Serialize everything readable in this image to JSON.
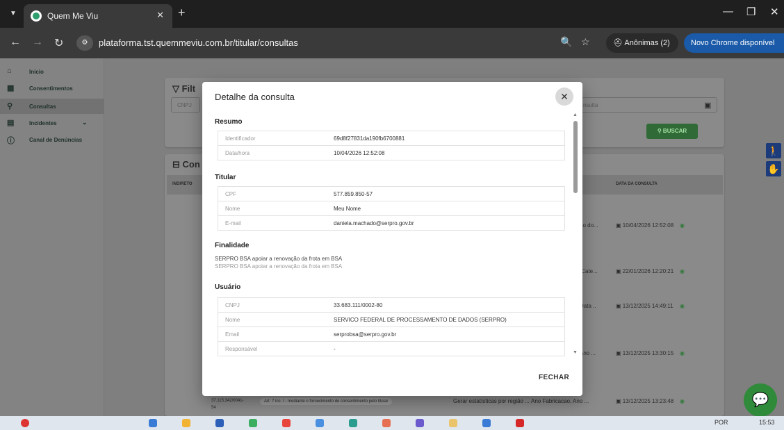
{
  "browser": {
    "tab_title": "Quem Me Viu",
    "url": "plataforma.tst.quemmeviu.com.br/titular/consultas",
    "incognito_label": "Anônimas (2)",
    "update_label": "Novo Chrome disponível"
  },
  "sidebar": {
    "items": [
      {
        "label": "Início",
        "icon": "home-icon"
      },
      {
        "label": "Consentimentos",
        "icon": "grid-icon"
      },
      {
        "label": "Consultas",
        "icon": "search-icon"
      },
      {
        "label": "Incidentes",
        "icon": "alert-icon"
      },
      {
        "label": "Canal de Denúncias",
        "icon": "info-icon"
      }
    ]
  },
  "background": {
    "filter_title": "Filt",
    "cnpj_placeholder": "CNPJ",
    "date_placeholder": "nsulta",
    "buscar_label": "BUSCAR",
    "list_title": "Con",
    "col_indireto": "INDIRETO",
    "col_data": "DATA DA CONSULTA",
    "rows": [
      {
        "frag": "ão do...",
        "date": "10/04/2026 12:52:08"
      },
      {
        "frag": "/Cate...",
        "date": "22/01/2026 12:20:21"
      },
      {
        "frag": "Data ..",
        "date": "13/12/2025 14:49:11"
      },
      {
        "frag": "Ano ...",
        "date": "13/12/2025 13:30:15"
      }
    ],
    "last_row": {
      "cnpj": "37.115.342/0041-",
      "cnpj2": "54",
      "legal_basis": "Art. 7 inc. I - mediante o fornecimento de consentimento pelo titular",
      "purpose": "Gerar estatísticas por região ...",
      "data": "Ano Fabricacao, Ano ...",
      "date": "13/12/2025 13:23:48"
    }
  },
  "modal": {
    "title": "Detalhe da consulta",
    "close_label": "FECHAR",
    "resumo": {
      "title": "Resumo",
      "rows": [
        {
          "key": "Identificador",
          "value": "69d8f27831da190fb6700881"
        },
        {
          "key": "Data/hora",
          "value": "10/04/2026 12:52:08"
        }
      ]
    },
    "titular": {
      "title": "Titular",
      "rows": [
        {
          "key": "CPF",
          "value": "577.859.850-57"
        },
        {
          "key": "Nome",
          "value": "Meu Nome"
        },
        {
          "key": "E-mail",
          "value": "daniela.machado@serpro.gov.br"
        }
      ]
    },
    "finalidade": {
      "title": "Finalidade",
      "line1": "SERPRO BSA apoiar a renovação da frota em BSA",
      "line2": "SERPRO BSA apoiar a renovação da frota em BSA"
    },
    "usuario": {
      "title": "Usuário",
      "rows": [
        {
          "key": "CNPJ",
          "value": "33.683.111/0002-80"
        },
        {
          "key": "Nome",
          "value": "SERVICO FEDERAL DE PROCESSAMENTO DE DADOS (SERPRO)"
        },
        {
          "key": "Email",
          "value": "serprobsa@serpro.gov.br"
        },
        {
          "key": "Responsável",
          "value": "-"
        }
      ]
    }
  },
  "taskbar": {
    "lang": "POR",
    "time": "15:53"
  },
  "colors": {
    "accent_green": "#2f6a37",
    "update_blue": "#1a5aa8",
    "access_blue": "#1b3b7a"
  }
}
